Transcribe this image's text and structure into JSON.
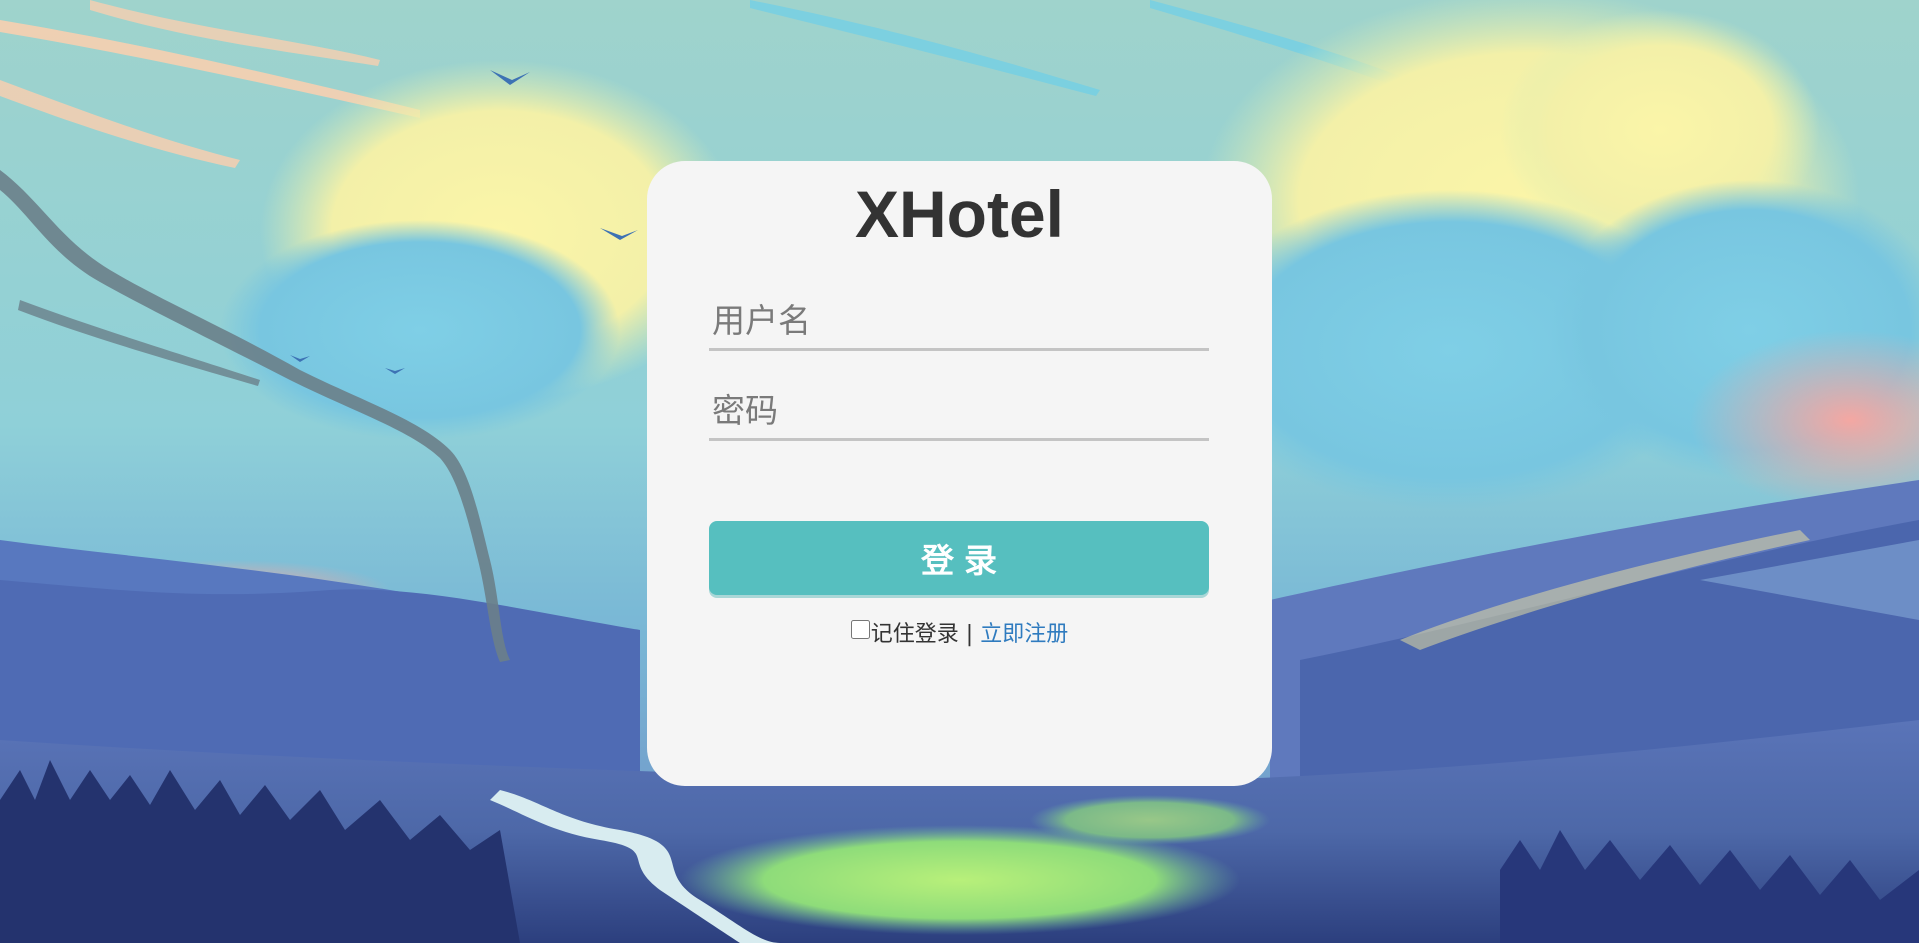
{
  "login": {
    "title": "XHotel",
    "username_placeholder": "用户名",
    "password_placeholder": "密码",
    "login_button": "登录",
    "remember_label": "记住登录",
    "separator": "|",
    "register_link": "立即注册"
  },
  "colors": {
    "card_bg": "#f5f5f5",
    "button_bg": "#56bfbf",
    "link": "#2f7bbf",
    "title": "#333333"
  },
  "icons": [
    "remember-checkbox"
  ]
}
